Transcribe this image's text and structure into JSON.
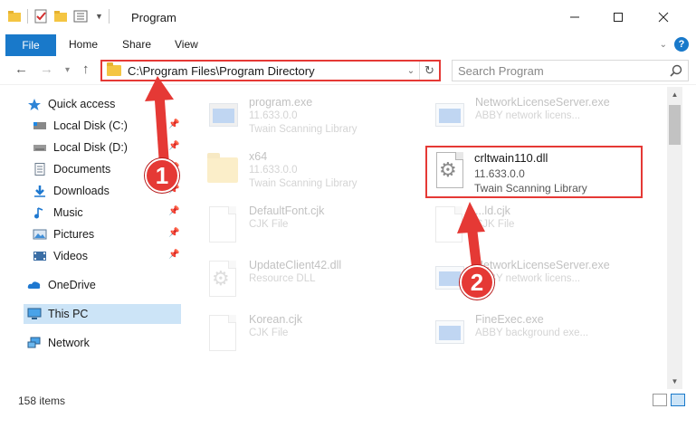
{
  "window": {
    "title": "Program"
  },
  "ribbon": {
    "tabs": [
      "File",
      "Home",
      "Share",
      "View"
    ],
    "help": "?"
  },
  "nav": {
    "address": "C:\\Program Files\\Program Directory",
    "search_placeholder": "Search Program"
  },
  "sidebar": {
    "items": [
      {
        "label": "Quick access",
        "icon": "star-icon",
        "pinned": false
      },
      {
        "label": "Local Disk (C:)",
        "icon": "drive-icon",
        "pinned": true
      },
      {
        "label": "Local Disk (D:)",
        "icon": "drive-icon",
        "pinned": true
      },
      {
        "label": "Documents",
        "icon": "documents-icon",
        "pinned": true
      },
      {
        "label": "Downloads",
        "icon": "downloads-icon",
        "pinned": true
      },
      {
        "label": "Music",
        "icon": "music-icon",
        "pinned": true
      },
      {
        "label": "Pictures",
        "icon": "pictures-icon",
        "pinned": true
      },
      {
        "label": "Videos",
        "icon": "videos-icon",
        "pinned": true
      },
      {
        "label": "OneDrive",
        "icon": "onedrive-icon",
        "pinned": false
      },
      {
        "label": "This PC",
        "icon": "pc-icon",
        "pinned": false,
        "selected": true
      },
      {
        "label": "Network",
        "icon": "network-icon",
        "pinned": false
      }
    ]
  },
  "files": [
    {
      "name": "program.exe",
      "line1": "11.633.0.0",
      "line2": "Twain Scanning Library",
      "icon": "app-icon"
    },
    {
      "name": "NetworkLicenseServer.exe",
      "line1": "ABBY network licens...",
      "line2": "",
      "icon": "window-icon"
    },
    {
      "name": "x64",
      "line1": "11.633.0.0",
      "line2": "Twain Scanning Library",
      "icon": "folder-icon"
    },
    {
      "name": "DefaultFont.cjk",
      "line1": "CJK File",
      "line2": "",
      "icon": "document-icon"
    },
    {
      "name": "...ld.cjk",
      "line1": "CJK File",
      "line2": "",
      "icon": "document-icon"
    },
    {
      "name": "UpdateClient42.dll",
      "line1": "Resource DLL",
      "line2": "",
      "icon": "gear-document-icon"
    },
    {
      "name": "NetworkLicenseServer.exe",
      "line1": "ABBY network licens...",
      "line2": "",
      "icon": "window-icon"
    },
    {
      "name": "Korean.cjk",
      "line1": "CJK File",
      "line2": "",
      "icon": "document-icon"
    },
    {
      "name": "FineExec.exe",
      "line1": "ABBY background exe...",
      "line2": "",
      "icon": "window-icon"
    }
  ],
  "highlighted_file": {
    "name": "crltwain110.dll",
    "version": "11.633.0.0",
    "description": "Twain Scanning Library"
  },
  "annotations": {
    "step1": "1",
    "step2": "2"
  },
  "status": {
    "item_count": "158 items"
  },
  "colors": {
    "accent": "#1979ca",
    "highlight": "#e53935"
  }
}
